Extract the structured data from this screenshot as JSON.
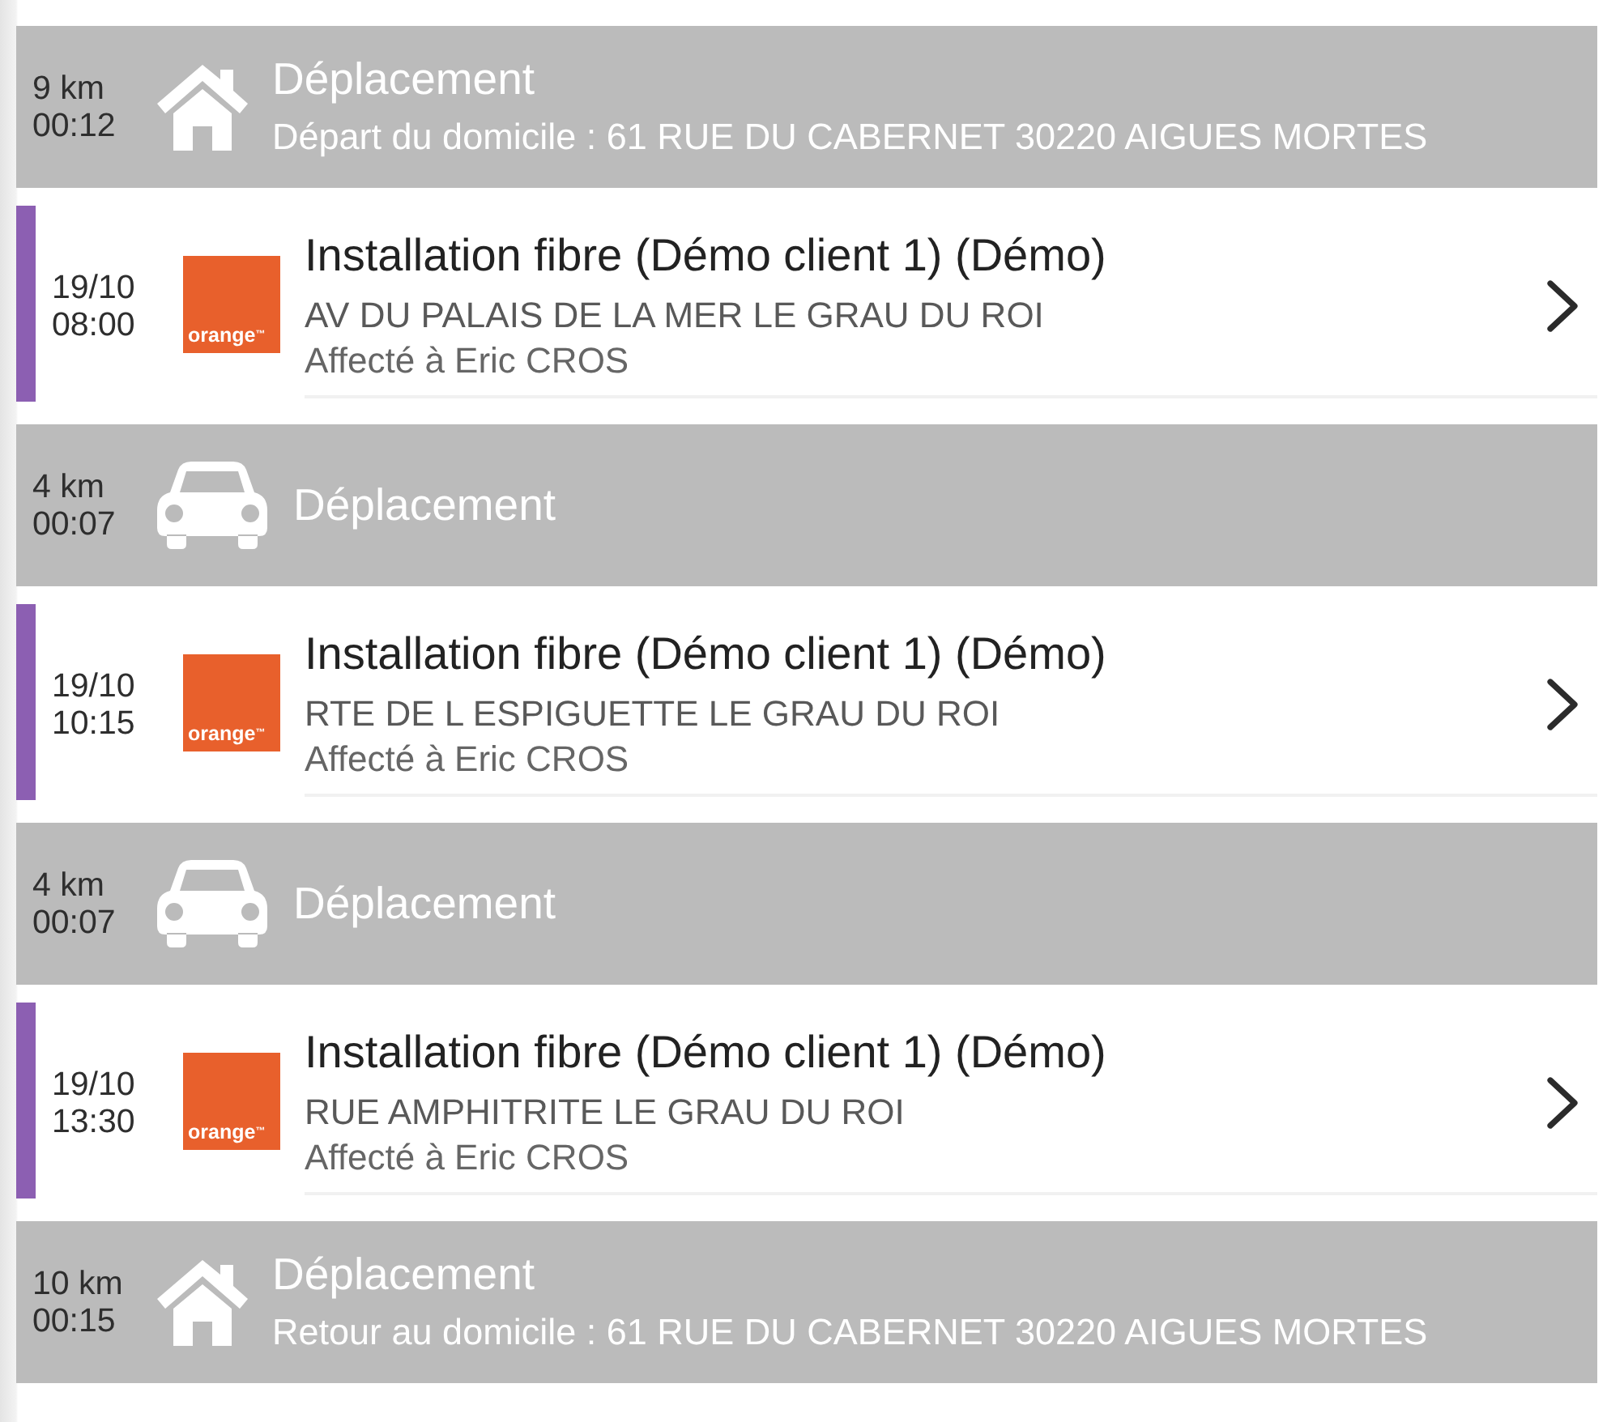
{
  "timeline": [
    {
      "kind": "home",
      "distance": "9 km",
      "duration": "00:12",
      "title": "Déplacement",
      "subtitle": "Départ du domicile : 61 RUE DU CABERNET 30220 AIGUES MORTES"
    },
    {
      "kind": "job",
      "color": "#8c5fb2",
      "date": "19/10",
      "time": "08:00",
      "logo_text": "orange$^{™}$",
      "title": "Installation fibre (Démo client 1) (Démo)",
      "address": "AV DU PALAIS DE LA MER LE GRAU DU ROI",
      "assignee": "Affecté à Eric CROS"
    },
    {
      "kind": "car",
      "distance": "4 km",
      "duration": "00:07",
      "title": "Déplacement"
    },
    {
      "kind": "job",
      "color": "#8c5fb2",
      "date": "19/10",
      "time": "10:15",
      "logo_text": "orange$^{™}$",
      "title": "Installation fibre (Démo client 1) (Démo)",
      "address": "RTE DE L ESPIGUETTE LE GRAU DU ROI",
      "assignee": "Affecté à Eric CROS"
    },
    {
      "kind": "car",
      "distance": "4 km",
      "duration": "00:07",
      "title": "Déplacement"
    },
    {
      "kind": "job",
      "color": "#8c5fb2",
      "date": "19/10",
      "time": "13:30",
      "logo_text": "orange$^{™}$",
      "title": "Installation fibre (Démo client 1) (Démo)",
      "address": "RUE AMPHITRITE LE GRAU DU ROI",
      "assignee": "Affecté à Eric CROS"
    },
    {
      "kind": "home",
      "distance": "10 km",
      "duration": "00:15",
      "title": "Déplacement",
      "subtitle": "Retour au domicile : 61 RUE DU CABERNET 30220 AIGUES MORTES"
    }
  ]
}
